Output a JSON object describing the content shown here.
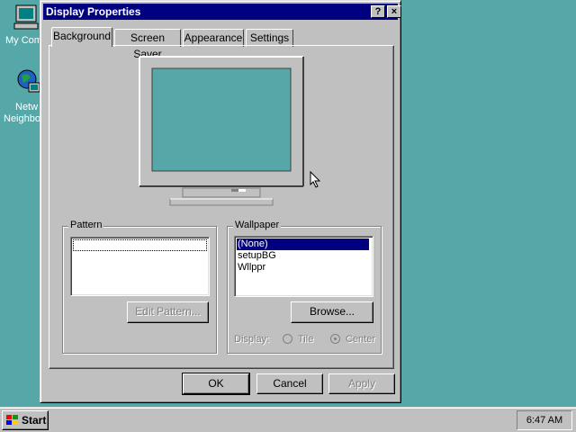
{
  "desktop": {
    "icons": [
      {
        "label": "My Com",
        "icon": "computer-icon"
      },
      {
        "label_line1": "Netw",
        "label_line2": "Neighbo",
        "icon": "network-icon"
      }
    ]
  },
  "window": {
    "title": "Display Properties",
    "help_button": "?",
    "close_button": "×",
    "tabs": [
      {
        "label": "Background",
        "active": true
      },
      {
        "label": "Screen Saver"
      },
      {
        "label": "Appearance"
      },
      {
        "label": "Settings"
      }
    ],
    "preview": {
      "screen_color": "#56a8a8"
    },
    "pattern": {
      "group_label": "Pattern",
      "selected": "",
      "edit_button": "Edit Pattern..."
    },
    "wallpaper": {
      "group_label": "Wallpaper",
      "items": [
        "(None)",
        "setupBG",
        "Wllppr"
      ],
      "selected": "(None)",
      "browse_button": "Browse...",
      "display_label": "Display:",
      "tile_label": "Tile",
      "center_label": "Center",
      "display_selected": "Center"
    },
    "buttons": {
      "ok": "OK",
      "cancel": "Cancel",
      "apply": "Apply"
    }
  },
  "taskbar": {
    "start_label": "Start",
    "clock": "6:47 AM"
  },
  "colors": {
    "desktop": "#56a8a8",
    "titlebar": "#000080",
    "face": "#c0c0c0",
    "selection": "#000080"
  }
}
